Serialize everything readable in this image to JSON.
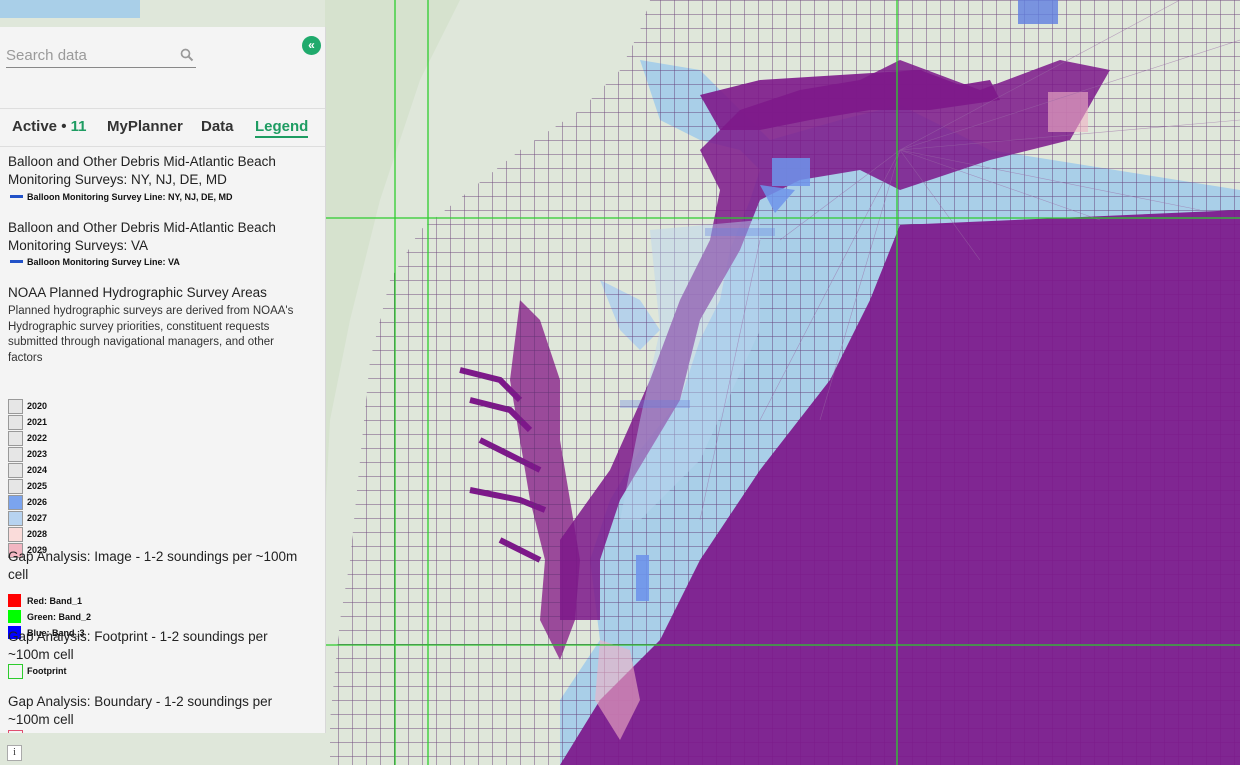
{
  "search": {
    "placeholder": "Search data"
  },
  "tabs": [
    {
      "label": "Active •",
      "count": "11"
    },
    {
      "label": "MyPlanner"
    },
    {
      "label": "Data"
    },
    {
      "label": "Legend"
    }
  ],
  "legend": {
    "balloon_ny": {
      "title": "Balloon and Other Debris Mid-Atlantic Beach Monitoring Surveys: NY, NJ, DE, MD",
      "item": "Balloon Monitoring Survey Line: NY, NJ, DE, MD"
    },
    "balloon_va": {
      "title": "Balloon and Other Debris Mid-Atlantic Beach Monitoring Surveys: VA",
      "item": "Balloon Monitoring Survey Line: VA"
    },
    "noaa": {
      "title": "NOAA Planned Hydrographic Survey Areas",
      "description": "Planned hydrographic surveys are derived from NOAA's Hydrographic survey priorities, constituent requests submitted through navigational managers, and other factors",
      "years": [
        {
          "label": "2020",
          "color": "#e6e6e6"
        },
        {
          "label": "2021",
          "color": "#e6e6e6"
        },
        {
          "label": "2022",
          "color": "#e6e6e6"
        },
        {
          "label": "2023",
          "color": "#e6e6e6"
        },
        {
          "label": "2024",
          "color": "#e6e6e6"
        },
        {
          "label": "2025",
          "color": "#e6e6e6"
        },
        {
          "label": "2026",
          "color": "#7ba4ee"
        },
        {
          "label": "2027",
          "color": "#b7d3f0"
        },
        {
          "label": "2028",
          "color": "#fadcda"
        },
        {
          "label": "2029",
          "color": "#f2b6c2"
        }
      ]
    },
    "gap_image": {
      "title": "Gap Analysis: Image - 1-2 soundings per ~100m cell",
      "bands": [
        {
          "label": "Red: Band_1",
          "color": "#ff0000"
        },
        {
          "label": "Green: Band_2",
          "color": "#00ff00"
        },
        {
          "label": "Blue: Band_3",
          "color": "#0000ff"
        }
      ]
    },
    "gap_footprint": {
      "title": "Gap Analysis: Footprint - 1-2 soundings per ~100m cell",
      "item": "Footprint"
    },
    "gap_boundary": {
      "title": "Gap Analysis: Boundary - 1-2 soundings per ~100m cell"
    }
  },
  "map": {
    "colors": {
      "land": "#dfe7da",
      "water": "#a9cfe8",
      "gap_fill": "#7d188a",
      "grid_line": "#6b2a7a",
      "footprint_line": "#2ecc2e",
      "survey_blue": "#6e94ea",
      "survey_pink": "#f0b1c4"
    }
  },
  "info_label": "i"
}
